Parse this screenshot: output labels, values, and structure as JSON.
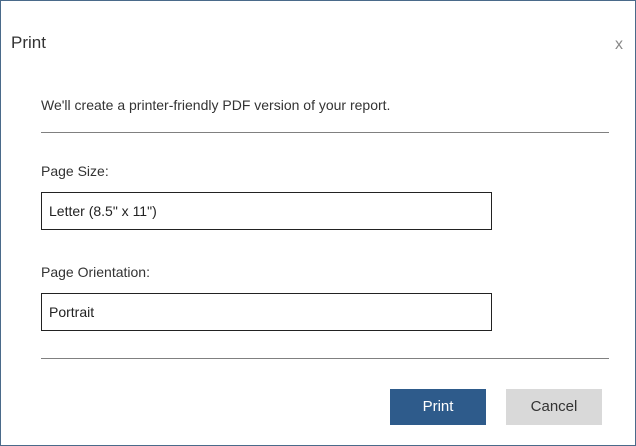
{
  "dialog": {
    "title": "Print",
    "close_label": "x",
    "intro": "We'll create a printer-friendly PDF version of your report.",
    "page_size": {
      "label": "Page Size:",
      "value": "Letter (8.5\" x 11\")"
    },
    "page_orientation": {
      "label": "Page Orientation:",
      "value": "Portrait"
    },
    "buttons": {
      "print": "Print",
      "cancel": "Cancel"
    }
  },
  "colors": {
    "primary_button": "#2e5b8b",
    "secondary_button": "#d9d9d9",
    "dialog_border": "#4a6a8a"
  }
}
